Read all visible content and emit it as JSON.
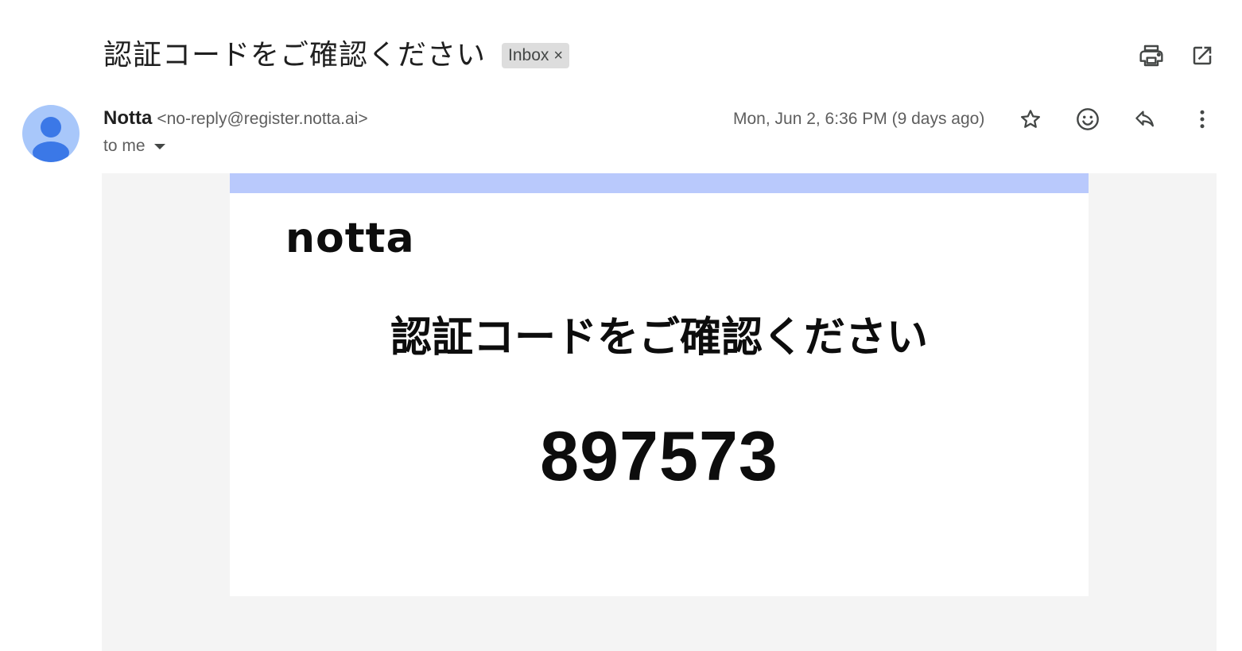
{
  "email": {
    "subject": "認証コードをご確認ください",
    "label": "Inbox",
    "label_remove": "×",
    "sender_name": "Notta",
    "sender_email": "<no-reply@register.notta.ai>",
    "recipient": "to me",
    "date": "Mon, Jun 2, 6:36 PM (9 days ago)"
  },
  "icons": {
    "print": "print-icon",
    "open_new_window": "open-in-new-window-icon",
    "star": "star-icon",
    "emoji": "emoji-reaction-icon",
    "reply": "reply-icon",
    "more": "more-vert-icon"
  },
  "body": {
    "logo": "notta",
    "heading": "認証コードをご確認ください",
    "code": "897573"
  },
  "colors": {
    "accent_bar": "#b9c9fc",
    "avatar_bg": "#a8c7fa",
    "avatar_fg": "#3b78e7",
    "body_bg": "#f4f4f4"
  }
}
